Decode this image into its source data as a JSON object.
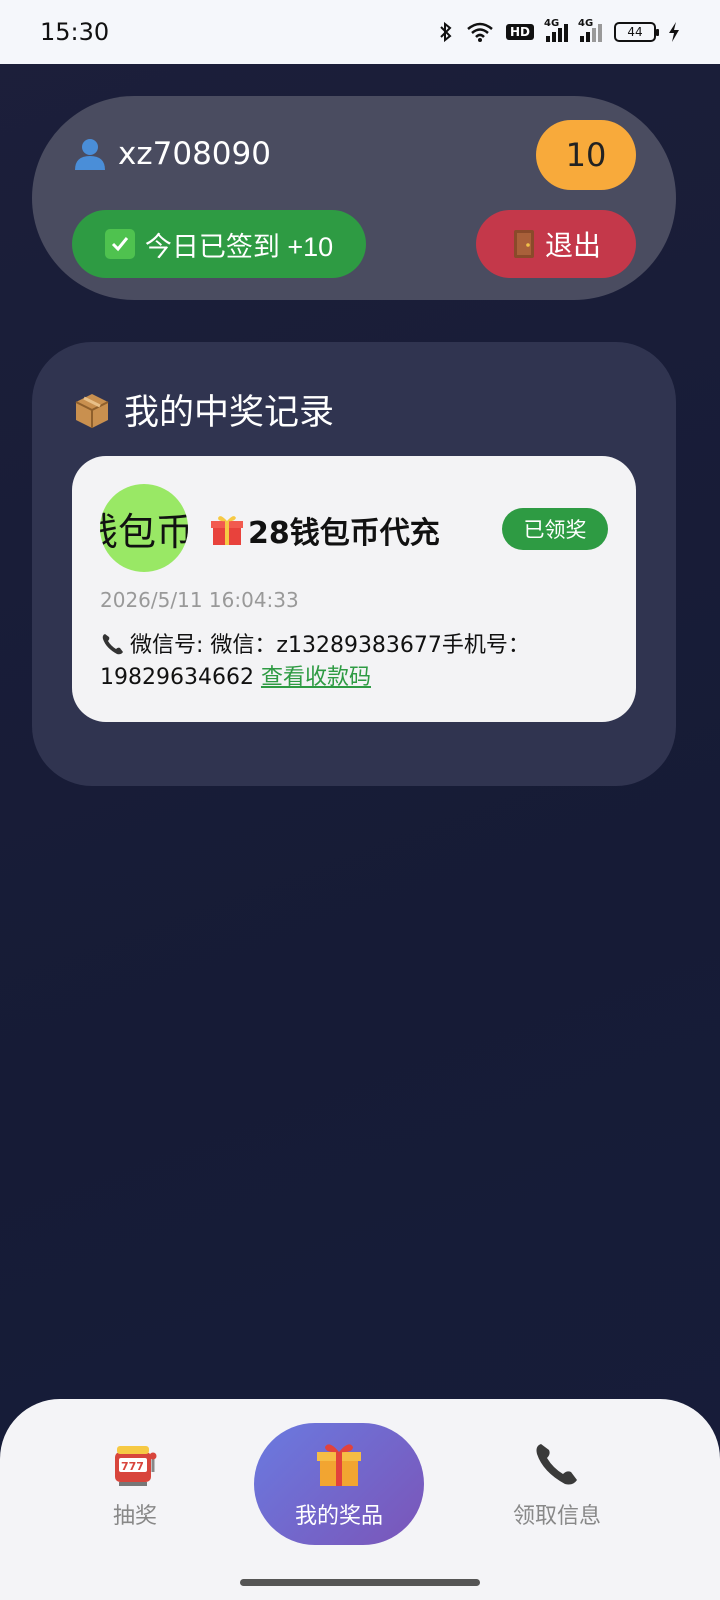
{
  "status_bar": {
    "time": "15:30",
    "hd_label": "HD",
    "signal1_label": "4G",
    "signal2_label": "4G",
    "battery": "44"
  },
  "user": {
    "username": "xz708090",
    "points": "10",
    "checkin_label": "今日已签到 +10",
    "logout_label": "退出"
  },
  "records": {
    "title": "我的中奖记录",
    "items": [
      {
        "thumb_text": "钱包币",
        "prize_name": "28钱包币代充",
        "status": "已领奖",
        "time": "2026/5/11 16:04:33",
        "contact": "微信号: 微信：z13289383677手机号：19829634662",
        "qr_link": "查看收款码"
      }
    ]
  },
  "nav": {
    "items": [
      {
        "label": "抽奖",
        "icon": "slot-machine-icon"
      },
      {
        "label": "我的奖品",
        "icon": "gift-icon"
      },
      {
        "label": "领取信息",
        "icon": "phone-icon"
      }
    ]
  },
  "colors": {
    "bg": "#1a1e3a",
    "points": "#f8aa3b",
    "checkin": "#2e9b43",
    "logout": "#c4384a",
    "nav_active_start": "#6a7ae0",
    "nav_active_end": "#7b55b8"
  }
}
